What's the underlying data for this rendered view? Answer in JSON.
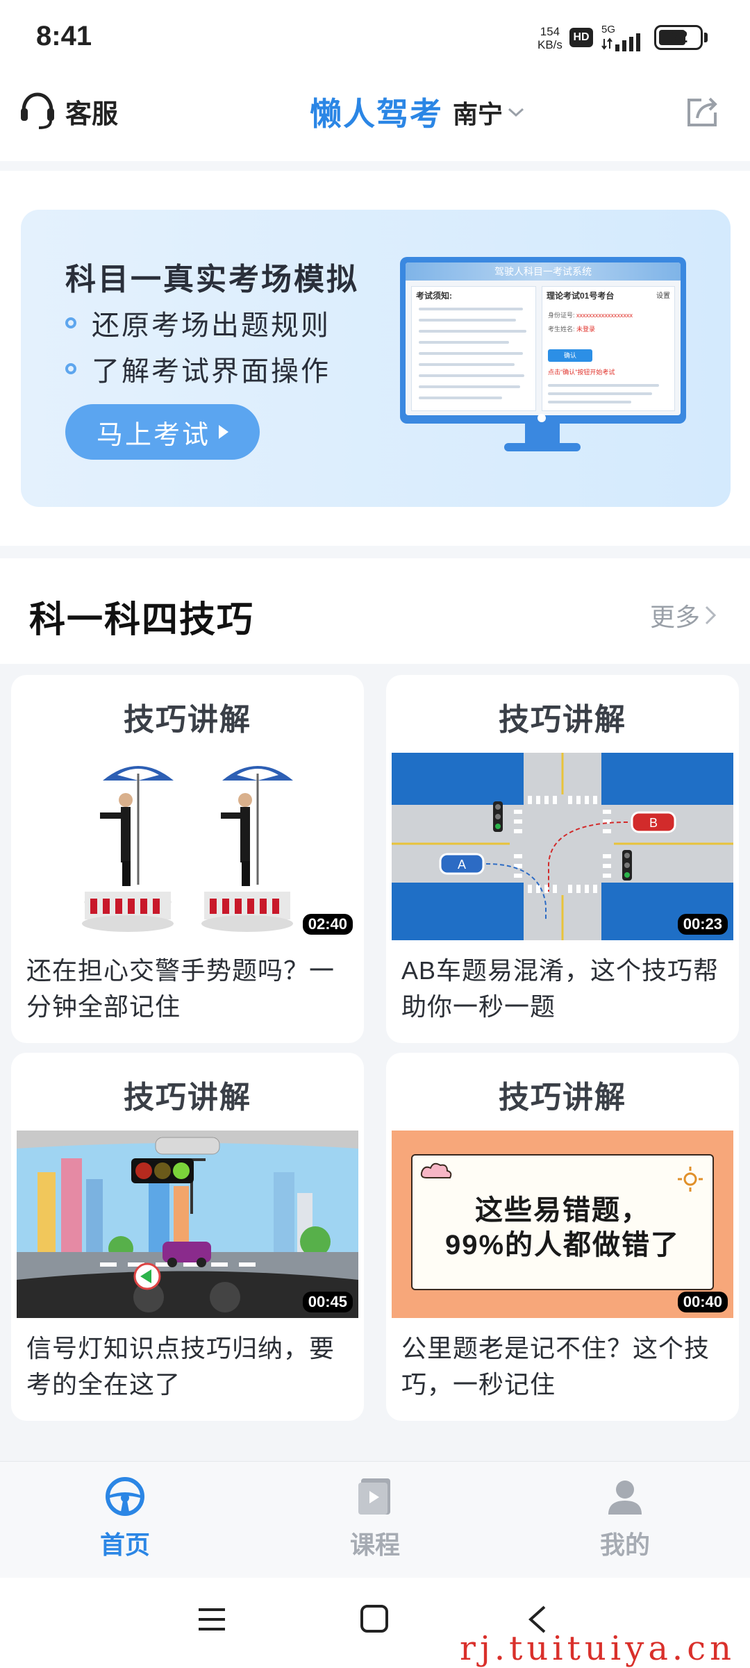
{
  "status_bar": {
    "time": "8:41",
    "speed_value": "154",
    "speed_unit": "KB/s",
    "hd": "HD",
    "network": "5G",
    "battery": "62"
  },
  "header": {
    "service_label": "客服",
    "brand": "懒人驾考",
    "city": "南宁"
  },
  "banner": {
    "title": "科目一真实考场模拟",
    "points": [
      "还原考场出题规则",
      "了解考试界面操作"
    ],
    "button_label": "马上考试",
    "screen": {
      "topbar": "驾驶人科目一考试系统",
      "left_title": "考试须知:",
      "right_title": "理论考试01号考台",
      "settings": "设置",
      "row1_label": "身份证号:",
      "row1_value": "xxxxxxxxxxxxxxxxxx",
      "row2_label": "考生姓名:",
      "row2_value": "未登录",
      "confirm": "确认",
      "hint": "点击\"确认\"按钮开始考试"
    }
  },
  "section": {
    "title": "科一科四技巧",
    "more_label": "更多"
  },
  "cards": [
    {
      "head": "技巧讲解",
      "duration": "02:40",
      "desc": "还在担心交警手势题吗？一分钟全部记住"
    },
    {
      "head": "技巧讲解",
      "duration": "00:23",
      "desc": "AB车题易混淆，这个技巧帮助你一秒一题"
    },
    {
      "head": "技巧讲解",
      "duration": "00:45",
      "desc": "信号灯知识点技巧归纳，要考的全在这了"
    },
    {
      "head": "技巧讲解",
      "duration": "00:40",
      "desc": "公里题老是记不住？这个技巧，一秒记住",
      "poster_lines": [
        "这些易错题，",
        "99%的人都做错了"
      ]
    }
  ],
  "bottom_nav": [
    {
      "label": "首页",
      "icon": "steering-wheel-icon",
      "active": true
    },
    {
      "label": "课程",
      "icon": "video-course-icon",
      "active": false
    },
    {
      "label": "我的",
      "icon": "user-icon",
      "active": false
    }
  ],
  "watermark": "rj.tuituiya.cn",
  "colors": {
    "brand_blue": "#2b86e5",
    "banner_bg": "#d9ecfd",
    "button_blue": "#5ba5f0",
    "inactive_gray": "#a6abb3"
  }
}
